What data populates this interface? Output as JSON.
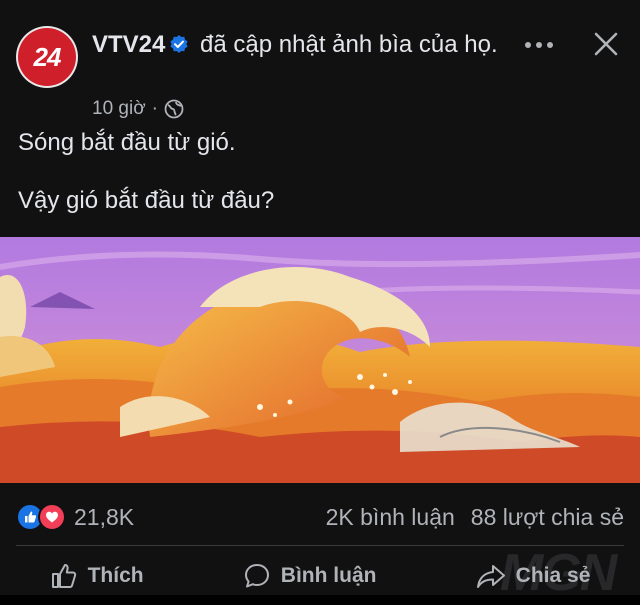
{
  "post": {
    "page_name": "VTV24",
    "avatar_text": "24",
    "header_action": "đã cập nhật ảnh bìa của họ.",
    "time": "10 giờ",
    "separator": "·",
    "caption_lines": [
      "Sóng bắt đầu từ gió.",
      "Vậy gió bắt đầu từ đâu?"
    ]
  },
  "stats": {
    "reaction_count": "21,8K",
    "comments": "2K bình luận",
    "shares": "88 lượt chia sẻ"
  },
  "actions": {
    "like": "Thích",
    "comment": "Bình luận",
    "share": "Chia sẻ"
  },
  "watermark": "MGN",
  "colors": {
    "background": "#111112",
    "text": "#e4e6eb",
    "secondary_text": "#b0b3b8",
    "verified": "#1b74e4",
    "avatar": "#cf1f2a",
    "love": "#f33e58"
  },
  "icons": [
    "verified-icon",
    "globe-icon",
    "more-icon",
    "close-icon",
    "like-reaction-icon",
    "love-reaction-icon",
    "thumbs-up-icon",
    "comment-icon",
    "share-icon"
  ]
}
